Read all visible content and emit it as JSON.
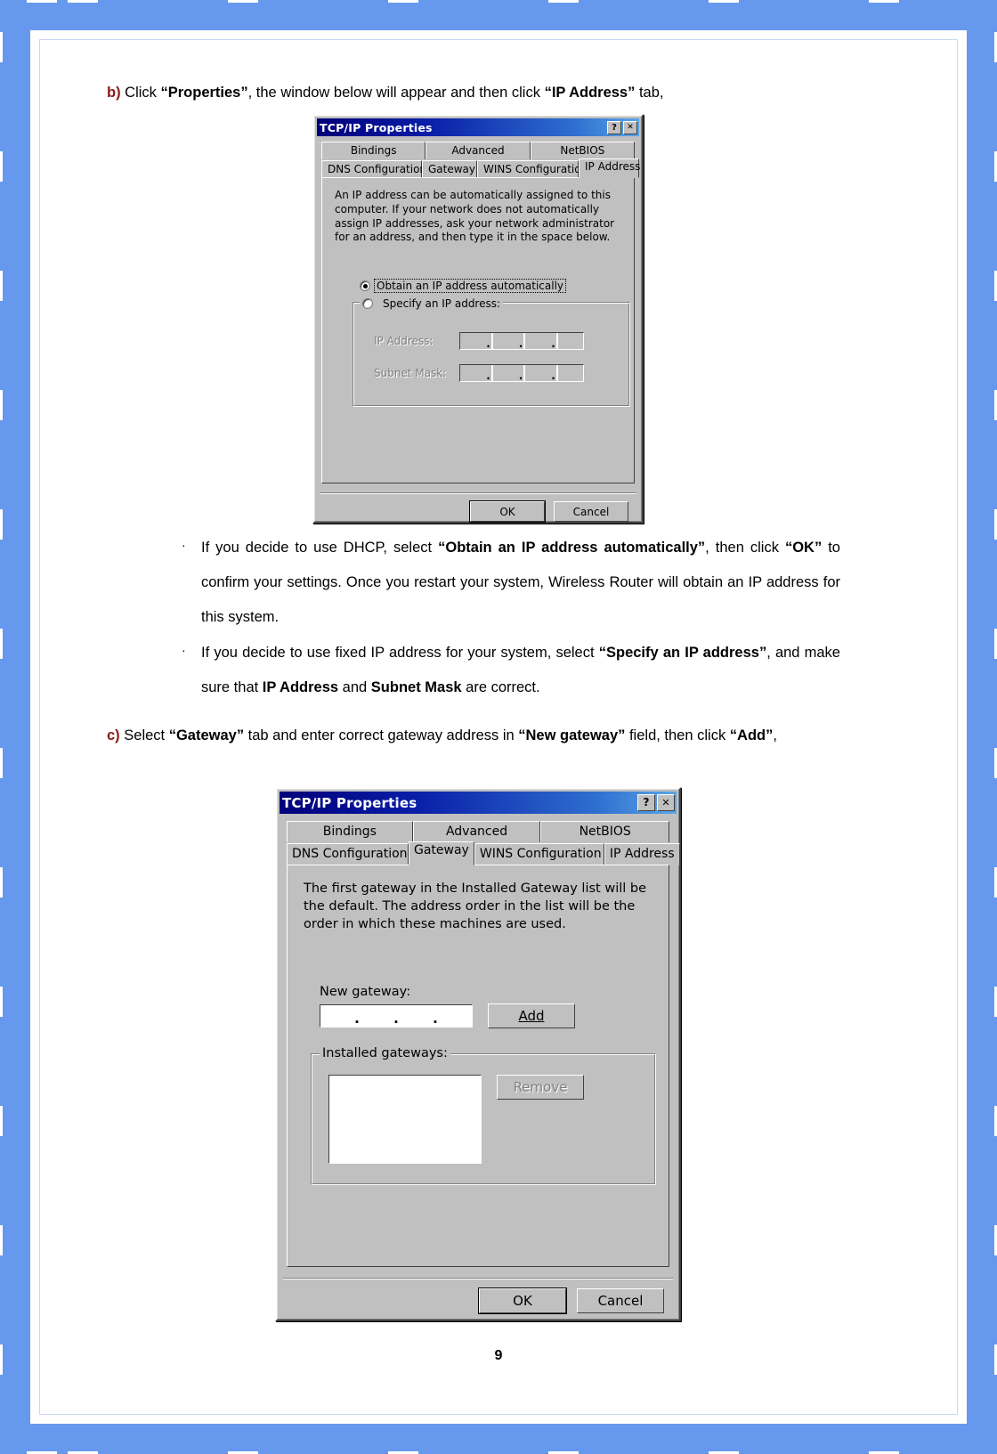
{
  "page": {
    "number": "9"
  },
  "steps": {
    "b": {
      "marker": "b)",
      "text_1": " Click ",
      "bold_1": "“Properties”",
      "text_2": ", the window below will appear and then click ",
      "bold_2": "“IP Address”",
      "text_3": " tab,"
    },
    "c": {
      "marker": "c)",
      "text_1": " Select ",
      "bold_1": "“Gateway”",
      "text_2": " tab and enter correct gateway address in ",
      "bold_2": "“New gateway”",
      "text_3": " field, then click ",
      "bold_3": "“Add”",
      "text_4": ","
    }
  },
  "bullets": [
    {
      "marker": "·",
      "segments": [
        {
          "t": "If you decide to use DHCP, select ",
          "b": false
        },
        {
          "t": "“Obtain an IP address automatically”",
          "b": true
        },
        {
          "t": ", then click ",
          "b": false
        },
        {
          "t": "“OK”",
          "b": true
        },
        {
          "t": " to confirm your settings. Once you restart your system, Wireless Router will obtain an IP address for this system.",
          "b": false
        }
      ]
    },
    {
      "marker": "·",
      "segments": [
        {
          "t": "If you decide to use fixed IP address for your system, select ",
          "b": false
        },
        {
          "t": "“Specify an IP address”",
          "b": true
        },
        {
          "t": ", and make sure that ",
          "b": false
        },
        {
          "t": "IP Address",
          "b": true
        },
        {
          "t": " and ",
          "b": false
        },
        {
          "t": "Subnet Mask",
          "b": true
        },
        {
          "t": " are correct.",
          "b": false
        }
      ]
    }
  ],
  "dialog_ip": {
    "title": "TCP/IP Properties",
    "help_button": "?",
    "close_button": "✕",
    "tabs_row1": [
      "Bindings",
      "Advanced",
      "NetBIOS"
    ],
    "tabs_row2": [
      "DNS Configuration",
      "Gateway",
      "WINS Configuration",
      "IP Address"
    ],
    "selected_tab": "IP Address",
    "description": "An IP address can be automatically assigned to this computer. If your network does not automatically assign IP addresses, ask your network administrator for an address, and then type it in the space below.",
    "radio_auto": {
      "label": "Obtain an IP address automatically",
      "accel": "O",
      "selected": true
    },
    "radio_specify": {
      "label": "Specify an IP address:",
      "accel": "S",
      "selected": false
    },
    "field_ip_label": "IP Address:",
    "field_ip_accel": "I",
    "field_ip_value": "",
    "field_subnet_label": "Subnet Mask:",
    "field_subnet_accel": "b",
    "field_subnet_value": "",
    "ip_dot": ".",
    "ok_button": "OK",
    "cancel_button": "Cancel"
  },
  "dialog_gateway": {
    "title": "TCP/IP Properties",
    "help_button": "?",
    "close_button": "✕",
    "tabs_row1": [
      "Bindings",
      "Advanced",
      "NetBIOS"
    ],
    "tabs_row2": [
      "DNS Configuration",
      "Gateway",
      "WINS Configuration",
      "IP Address"
    ],
    "selected_tab": "Gateway",
    "description": "The first gateway in the Installed Gateway list will be the default. The address order in the list will be the order in which these machines are used.",
    "new_gateway_label": "New gateway:",
    "new_gateway_accel": "N",
    "new_gateway_value": "",
    "gateway_dot": ".",
    "add_button": "Add",
    "add_accel": "A",
    "installed_group_label": "Installed gateways:",
    "installed_group_accel": "I",
    "installed_items": [],
    "remove_button": "Remove",
    "remove_accel": "R",
    "remove_disabled": true,
    "ok_button": "OK",
    "cancel_button": "Cancel"
  },
  "colors": {
    "page_border": "#6699ee",
    "marker_red": "#8b1a14",
    "dialog_face": "#c0c0c0",
    "titlebar_start": "#00007a",
    "titlebar_end": "#5aa6e8"
  }
}
